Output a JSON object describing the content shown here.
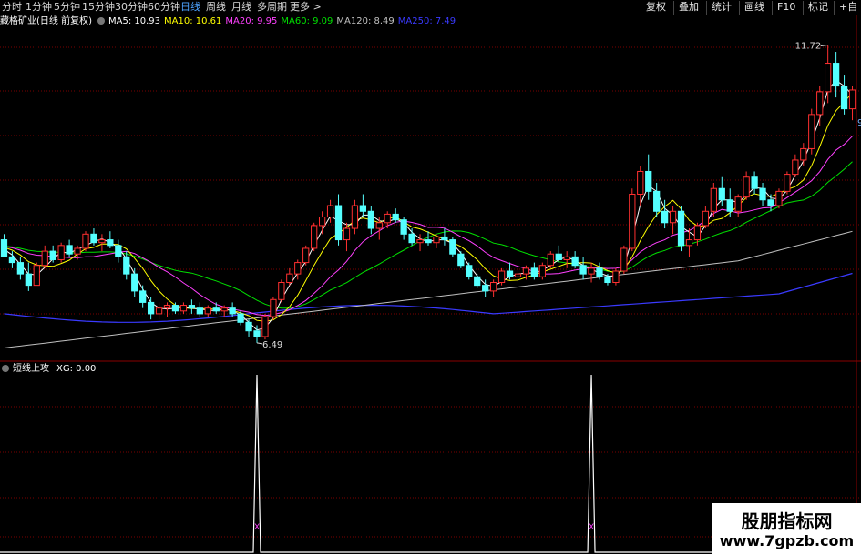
{
  "toolbar": {
    "periods": [
      "分时",
      "1分钟",
      "5分钟",
      "15分钟",
      "30分钟",
      "60分钟",
      "日线",
      "周线",
      "月线",
      "多周期",
      "更多 >"
    ],
    "active_period": "日线",
    "right_buttons": [
      "复权",
      "叠加",
      "统计",
      "画线",
      "F10",
      "标记",
      "+自"
    ]
  },
  "legend": {
    "title": "藏格矿业(日线 前复权)",
    "ma5": "MA5: 10.93",
    "ma10": "MA10: 10.61",
    "ma20": "MA20: 9.95",
    "ma60": "MA60: 9.09",
    "ma120": "MA120: 8.49",
    "ma250": "MA250: 7.49"
  },
  "indicator": {
    "title": "短线上攻",
    "value": "XG: 0.00",
    "marker": "X"
  },
  "annotations": {
    "high": "11.72",
    "low": "6.49",
    "right_edge": "9"
  },
  "watermark": {
    "line1": "股朋指标网",
    "line2": "www.7gpzb.com"
  },
  "colors": {
    "up": "#ff3030",
    "down": "#54ffff",
    "ma5": "#ffffff",
    "ma10": "#ffff00",
    "ma20": "#ff40ff",
    "ma60": "#00e000",
    "ma120": "#c0c0c0",
    "ma250": "#3a3aff",
    "grid": "#7a0000"
  },
  "chart_data": {
    "type": "candlestick",
    "price_range": [
      6.2,
      12.0
    ],
    "ohlc": [
      [
        8.3,
        8.4,
        8.0,
        8.0
      ],
      [
        8.0,
        8.1,
        7.8,
        7.9
      ],
      [
        7.9,
        8.0,
        7.6,
        7.7
      ],
      [
        7.7,
        7.9,
        7.4,
        7.5
      ],
      [
        7.5,
        7.9,
        7.5,
        7.85
      ],
      [
        7.85,
        8.2,
        7.8,
        8.1
      ],
      [
        8.1,
        8.2,
        7.9,
        7.95
      ],
      [
        7.95,
        8.25,
        7.9,
        8.2
      ],
      [
        8.2,
        8.3,
        8.0,
        8.05
      ],
      [
        8.05,
        8.2,
        7.95,
        8.15
      ],
      [
        8.15,
        8.45,
        8.1,
        8.4
      ],
      [
        8.4,
        8.5,
        8.2,
        8.25
      ],
      [
        8.25,
        8.4,
        8.1,
        8.3
      ],
      [
        8.3,
        8.45,
        8.15,
        8.2
      ],
      [
        8.2,
        8.3,
        7.9,
        8.0
      ],
      [
        8.0,
        8.1,
        7.6,
        7.7
      ],
      [
        7.7,
        7.8,
        7.3,
        7.4
      ],
      [
        7.4,
        7.5,
        7.1,
        7.2
      ],
      [
        7.2,
        7.3,
        6.9,
        7.0
      ],
      [
        7.0,
        7.2,
        6.9,
        7.1
      ],
      [
        7.1,
        7.2,
        6.95,
        7.15
      ],
      [
        7.15,
        7.2,
        7.0,
        7.05
      ],
      [
        7.05,
        7.2,
        7.0,
        7.15
      ],
      [
        7.15,
        7.25,
        7.0,
        7.1
      ],
      [
        7.1,
        7.2,
        6.95,
        7.0
      ],
      [
        7.0,
        7.15,
        6.95,
        7.1
      ],
      [
        7.1,
        7.2,
        7.0,
        7.05
      ],
      [
        7.05,
        7.15,
        6.95,
        7.1
      ],
      [
        7.1,
        7.2,
        6.95,
        7.0
      ],
      [
        7.0,
        7.05,
        6.8,
        6.85
      ],
      [
        6.85,
        6.9,
        6.6,
        6.7
      ],
      [
        6.7,
        6.8,
        6.49,
        6.6
      ],
      [
        6.6,
        7.0,
        6.55,
        6.95
      ],
      [
        6.95,
        7.3,
        6.9,
        7.25
      ],
      [
        7.25,
        7.6,
        7.2,
        7.55
      ],
      [
        7.55,
        7.8,
        7.5,
        7.7
      ],
      [
        7.7,
        7.95,
        7.6,
        7.9
      ],
      [
        7.9,
        8.2,
        7.85,
        8.15
      ],
      [
        8.15,
        8.6,
        8.1,
        8.55
      ],
      [
        8.55,
        8.8,
        8.4,
        8.7
      ],
      [
        8.7,
        9.0,
        8.6,
        8.9
      ],
      [
        8.9,
        9.1,
        8.2,
        8.3
      ],
      [
        8.3,
        8.6,
        8.1,
        8.5
      ],
      [
        8.5,
        9.0,
        8.4,
        8.9
      ],
      [
        8.9,
        9.1,
        8.7,
        8.8
      ],
      [
        8.8,
        8.9,
        8.4,
        8.5
      ],
      [
        8.5,
        8.7,
        8.3,
        8.6
      ],
      [
        8.6,
        8.8,
        8.5,
        8.75
      ],
      [
        8.75,
        8.85,
        8.6,
        8.65
      ],
      [
        8.65,
        8.7,
        8.3,
        8.4
      ],
      [
        8.4,
        8.5,
        8.2,
        8.25
      ],
      [
        8.25,
        8.4,
        8.1,
        8.3
      ],
      [
        8.3,
        8.45,
        8.2,
        8.25
      ],
      [
        8.25,
        8.4,
        8.15,
        8.35
      ],
      [
        8.35,
        8.5,
        8.2,
        8.3
      ],
      [
        8.3,
        8.35,
        8.0,
        8.05
      ],
      [
        8.05,
        8.1,
        7.8,
        7.85
      ],
      [
        7.85,
        7.9,
        7.6,
        7.65
      ],
      [
        7.65,
        7.7,
        7.45,
        7.5
      ],
      [
        7.5,
        7.6,
        7.3,
        7.4
      ],
      [
        7.4,
        7.6,
        7.3,
        7.55
      ],
      [
        7.55,
        7.8,
        7.5,
        7.75
      ],
      [
        7.75,
        7.9,
        7.6,
        7.65
      ],
      [
        7.65,
        7.8,
        7.55,
        7.7
      ],
      [
        7.7,
        7.85,
        7.6,
        7.8
      ],
      [
        7.8,
        7.9,
        7.6,
        7.65
      ],
      [
        7.65,
        7.9,
        7.6,
        7.85
      ],
      [
        7.85,
        8.1,
        7.8,
        8.05
      ],
      [
        8.05,
        8.2,
        7.9,
        7.95
      ],
      [
        7.95,
        8.1,
        7.8,
        8.0
      ],
      [
        8.0,
        8.1,
        7.8,
        7.85
      ],
      [
        7.85,
        8.0,
        7.6,
        7.7
      ],
      [
        7.7,
        7.9,
        7.55,
        7.8
      ],
      [
        7.8,
        7.9,
        7.6,
        7.65
      ],
      [
        7.65,
        7.7,
        7.5,
        7.55
      ],
      [
        7.55,
        7.8,
        7.5,
        7.75
      ],
      [
        7.75,
        8.2,
        7.7,
        8.15
      ],
      [
        8.15,
        9.2,
        8.1,
        9.1
      ],
      [
        9.1,
        9.6,
        8.9,
        9.5
      ],
      [
        9.5,
        9.8,
        9.0,
        9.15
      ],
      [
        9.15,
        9.3,
        8.7,
        8.8
      ],
      [
        8.8,
        9.0,
        8.5,
        8.6
      ],
      [
        8.6,
        8.9,
        8.4,
        8.8
      ],
      [
        8.8,
        8.9,
        8.1,
        8.2
      ],
      [
        8.2,
        8.5,
        8.0,
        8.3
      ],
      [
        8.3,
        8.6,
        8.2,
        8.55
      ],
      [
        8.55,
        8.9,
        8.5,
        8.8
      ],
      [
        8.8,
        9.3,
        8.7,
        9.2
      ],
      [
        9.2,
        9.4,
        8.9,
        9.0
      ],
      [
        9.0,
        9.2,
        8.7,
        8.8
      ],
      [
        8.8,
        9.1,
        8.7,
        9.05
      ],
      [
        9.05,
        9.5,
        9.0,
        9.4
      ],
      [
        9.4,
        9.5,
        9.1,
        9.2
      ],
      [
        9.2,
        9.3,
        8.9,
        9.0
      ],
      [
        9.0,
        9.1,
        8.8,
        8.9
      ],
      [
        8.9,
        9.2,
        8.85,
        9.15
      ],
      [
        9.15,
        9.5,
        9.1,
        9.45
      ],
      [
        9.45,
        9.8,
        9.4,
        9.7
      ],
      [
        9.7,
        10.0,
        9.6,
        9.9
      ],
      [
        9.9,
        10.6,
        9.8,
        10.5
      ],
      [
        10.5,
        11.0,
        10.3,
        10.9
      ],
      [
        10.9,
        11.72,
        10.7,
        11.4
      ],
      [
        11.4,
        11.6,
        10.8,
        11.0
      ],
      [
        11.0,
        11.2,
        10.5,
        10.6
      ],
      [
        10.6,
        11.0,
        10.4,
        10.93
      ]
    ],
    "signal_indices": [
      31,
      72
    ]
  }
}
